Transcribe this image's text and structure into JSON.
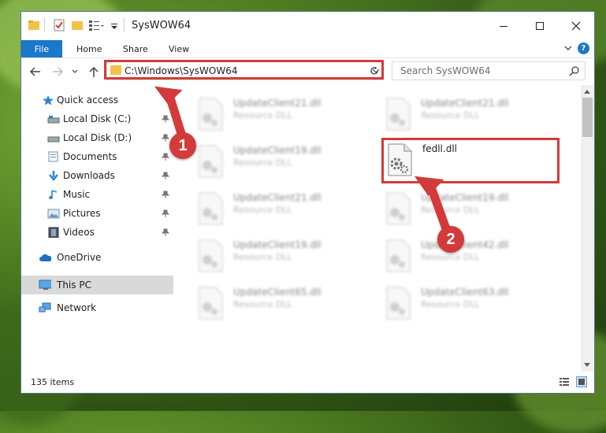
{
  "window": {
    "title": "SysWOW64",
    "controls": [
      "minimize-icon",
      "maximize-icon",
      "close-icon"
    ]
  },
  "ribbon": {
    "tabs": [
      {
        "label": "File"
      },
      {
        "label": "Home"
      },
      {
        "label": "Share"
      },
      {
        "label": "View"
      }
    ],
    "help_label": "?"
  },
  "navigation": {
    "address": "C:\\Windows\\SysWOW64",
    "search_placeholder": "Search SysWOW64"
  },
  "sidebar": {
    "items": [
      {
        "label": "Quick access",
        "icon": "star-icon",
        "pinned": false
      },
      {
        "label": "Local Disk (C:)",
        "icon": "drive-icon",
        "pinned": true
      },
      {
        "label": "Local Disk (D:)",
        "icon": "drive-icon",
        "pinned": true
      },
      {
        "label": "Documents",
        "icon": "documents-icon",
        "pinned": true
      },
      {
        "label": "Downloads",
        "icon": "download-icon",
        "pinned": true
      },
      {
        "label": "Music",
        "icon": "music-icon",
        "pinned": true
      },
      {
        "label": "Pictures",
        "icon": "pictures-icon",
        "pinned": true
      },
      {
        "label": "Videos",
        "icon": "videos-icon",
        "pinned": true
      },
      {
        "label": "OneDrive",
        "icon": "cloud-icon",
        "pinned": false
      },
      {
        "label": "This PC",
        "icon": "computer-icon",
        "pinned": false,
        "selected": true
      },
      {
        "label": "Network",
        "icon": "network-icon",
        "pinned": false
      }
    ]
  },
  "files": [
    {
      "name": "UpdateClient21.dll",
      "type": "Resource DLL",
      "blurred": true
    },
    {
      "name": "UpdateClient21.dll",
      "type": "Resource DLL",
      "blurred": true
    },
    {
      "name": "UpdateClient19.dll",
      "type": "Resource DLL",
      "blurred": true
    },
    {
      "name": "fedll.dll",
      "type": "",
      "blurred": false,
      "highlighted": true
    },
    {
      "name": "UpdateClient21.dll",
      "type": "Resource DLL",
      "blurred": true
    },
    {
      "name": "UpdateClient19.dll",
      "type": "Resource DLL",
      "blurred": true
    },
    {
      "name": "UpdateClient19.dll",
      "type": "Resource DLL",
      "blurred": true
    },
    {
      "name": "UpdateClient42.dll",
      "type": "Resource DLL",
      "blurred": true
    },
    {
      "name": "UpdateClient65.dll",
      "type": "Resource DLL",
      "blurred": true
    },
    {
      "name": "UpdateClient63.dll",
      "type": "Resource DLL",
      "blurred": true
    }
  ],
  "status": {
    "item_count": "135 items"
  },
  "annotations": [
    {
      "label": "1"
    },
    {
      "label": "2"
    }
  ],
  "colors": {
    "accent": "#1979ca",
    "highlight": "#d43a3a",
    "folder": "#f0c24a"
  }
}
